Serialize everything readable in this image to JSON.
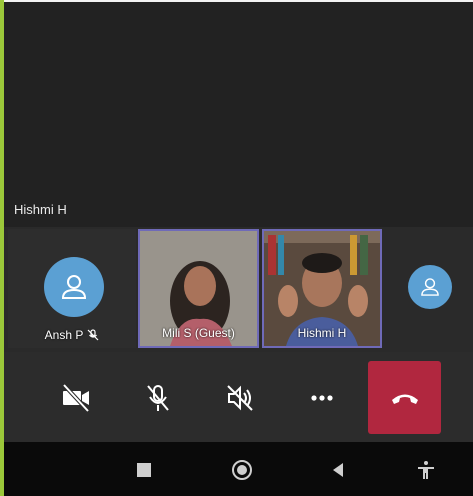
{
  "main_stage": {
    "active_speaker": "Hishmi H"
  },
  "participants": [
    {
      "name": "Ansh P",
      "muted": true,
      "video": false
    },
    {
      "name": "Mili S (Guest)",
      "muted": false,
      "video": true
    },
    {
      "name": "Hishmi H",
      "muted": false,
      "video": true
    },
    {
      "name": "",
      "muted": false,
      "video": false
    }
  ],
  "controls": {
    "video": "video-off-icon",
    "mic": "mic-off-icon",
    "speaker": "speaker-off-icon",
    "more": "more-options-icon",
    "hangup": "end-call-icon"
  },
  "colors": {
    "avatar": "#5ba0d3",
    "hangup": "#b1273f",
    "tile_border": "#6f6ab8",
    "accent_strip": "#9bc83a"
  }
}
